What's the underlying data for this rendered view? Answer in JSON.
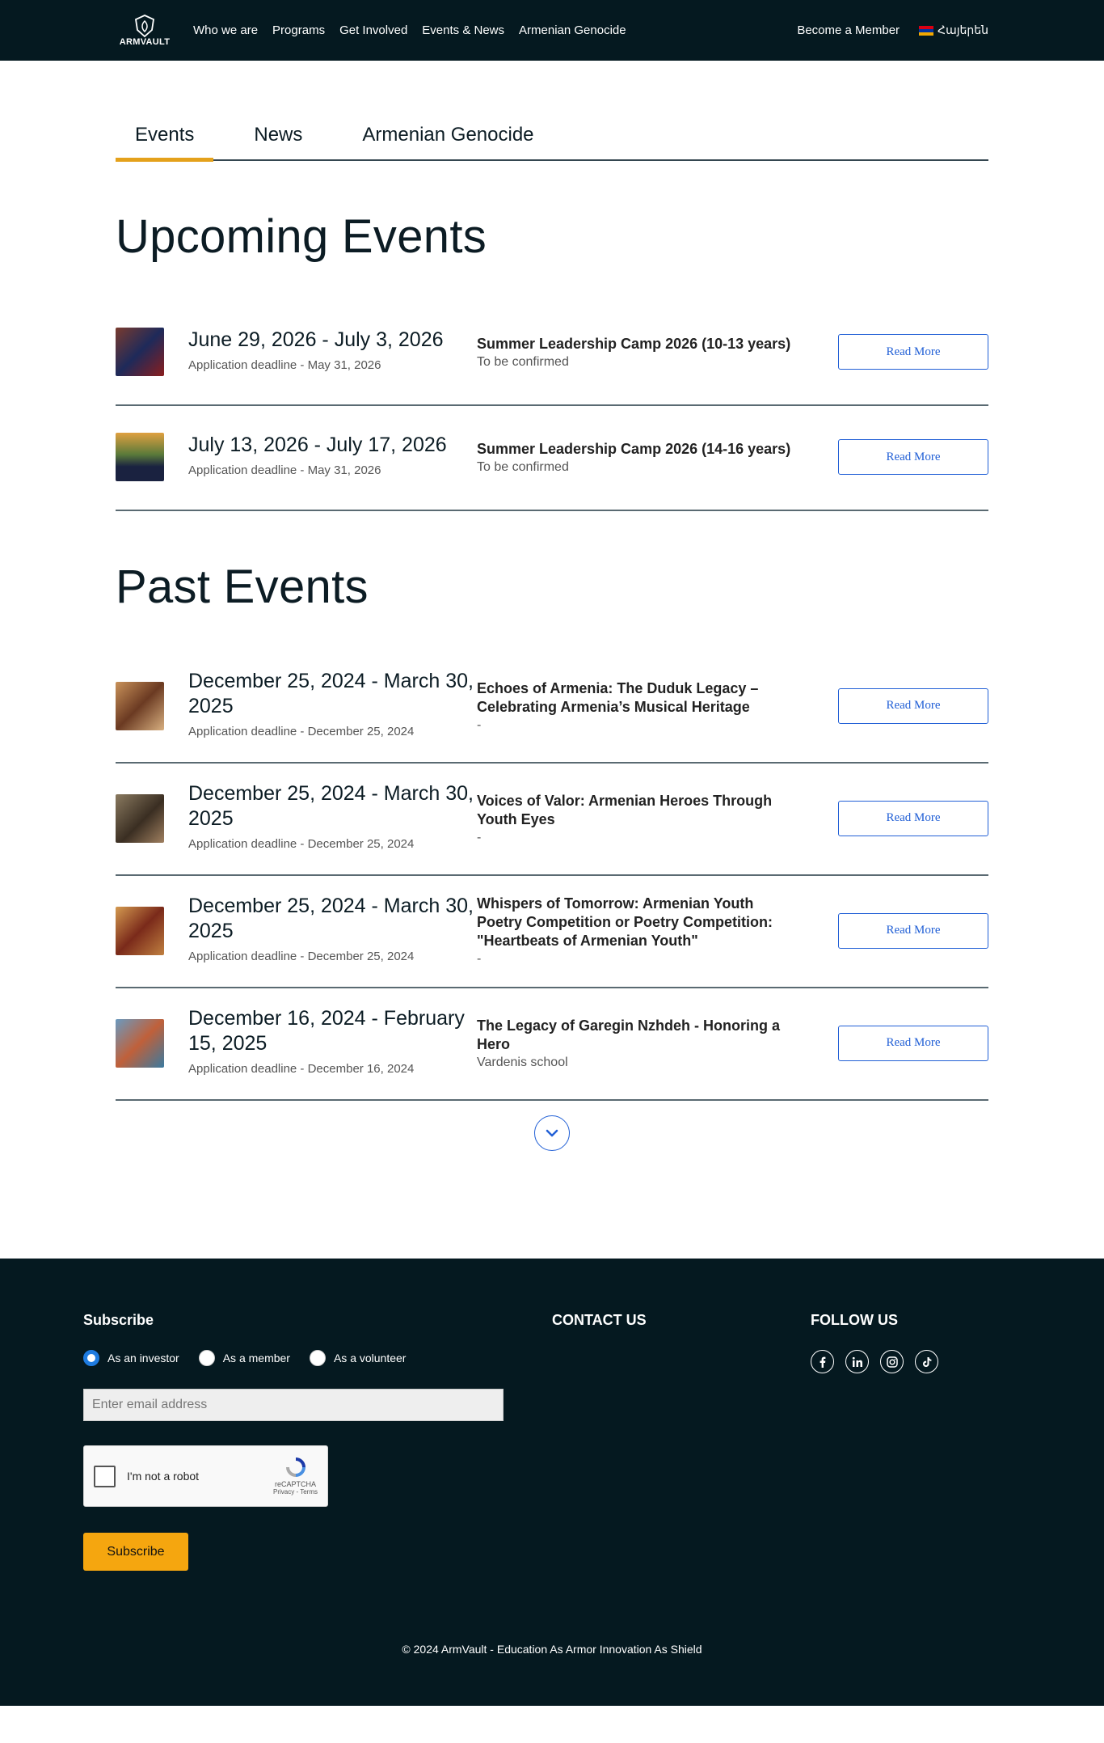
{
  "header": {
    "logo_text": "ARMVAULT",
    "nav": [
      "Who we are",
      "Programs",
      "Get Involved",
      "Events & News",
      "Armenian Genocide"
    ],
    "become_member": "Become a Member",
    "language": "Հայերեն"
  },
  "tabs": [
    "Events",
    "News",
    "Armenian Genocide"
  ],
  "upcoming": {
    "title": "Upcoming Events",
    "events": [
      {
        "date": "June 29, 2026 - July 3, 2026",
        "deadline": "Application deadline - May 31, 2026",
        "title": "Summer Leadership Camp 2026 (10-13 years)",
        "subtitle": "To be confirmed",
        "button": "Read More"
      },
      {
        "date": "July 13, 2026 - July 17, 2026",
        "deadline": "Application deadline - May 31, 2026",
        "title": "Summer Leadership Camp 2026 (14-16 years)",
        "subtitle": "To be confirmed",
        "button": "Read More"
      }
    ]
  },
  "past": {
    "title": "Past Events",
    "events": [
      {
        "date": "December 25, 2024 - March 30, 2025",
        "deadline": "Application deadline - December 25, 2024",
        "title": "Echoes of Armenia: The Duduk Legacy – Celebrating Armenia’s Musical Heritage",
        "subtitle": "-",
        "button": "Read More"
      },
      {
        "date": "December 25, 2024 - March 30, 2025",
        "deadline": "Application deadline - December 25, 2024",
        "title": "Voices of Valor: Armenian Heroes Through Youth Eyes",
        "subtitle": "-",
        "button": "Read More"
      },
      {
        "date": "December 25, 2024 - March 30, 2025",
        "deadline": "Application deadline - December 25, 2024",
        "title": "Whispers of Tomorrow: Armenian Youth Poetry Competition or Poetry Competition: \"Heartbeats of Armenian Youth\"",
        "subtitle": "-",
        "button": "Read More"
      },
      {
        "date": "December 16, 2024 - February 15, 2025",
        "deadline": "Application deadline - December 16, 2024",
        "title": "The Legacy of Garegin Nzhdeh - Honoring a Hero",
        "subtitle": "Vardenis school",
        "button": "Read More"
      }
    ]
  },
  "footer": {
    "subscribe_heading": "Subscribe",
    "radios": [
      "As an investor",
      "As a member",
      "As a volunteer"
    ],
    "email_placeholder": "Enter email address",
    "captcha_label": "I'm not a robot",
    "captcha_brand": "reCAPTCHA",
    "captcha_links": "Privacy - Terms",
    "subscribe_button": "Subscribe",
    "contact_heading": "CONTACT US",
    "follow_heading": "FOLLOW US",
    "copyright": "© 2024 ArmVault - Education As Armor Innovation As Shield"
  },
  "colors": {
    "header_bg": "#051920",
    "accent": "#e4a11b",
    "button_blue": "#2260d6",
    "subscribe": "#f5a60f"
  }
}
